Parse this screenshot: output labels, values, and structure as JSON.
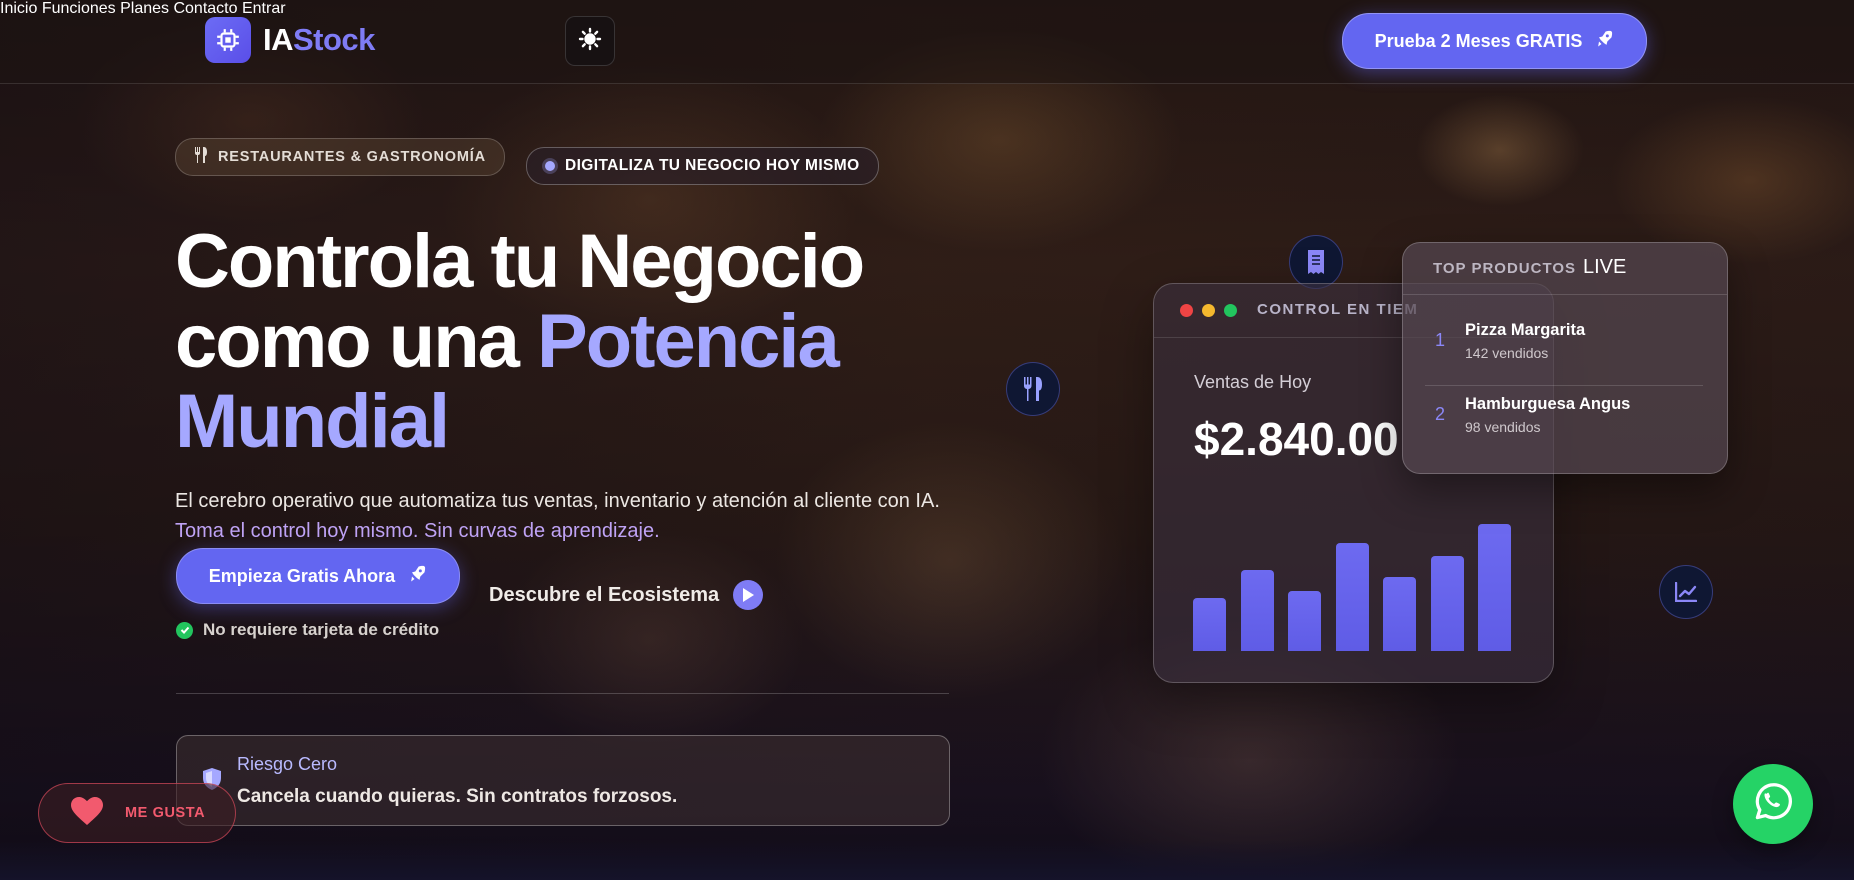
{
  "brand": {
    "prefix": "IA",
    "suffix": "Stock"
  },
  "nav": {
    "items": [
      "Inicio",
      "Funciones",
      "Planes",
      "Contacto",
      "Entrar"
    ],
    "cta_label": "Prueba 2 Meses GRATIS"
  },
  "badges": {
    "category": "RESTAURANTES & GASTRONOMÍA",
    "digitize": "DIGITALIZA TU NEGOCIO HOY MISMO"
  },
  "hero": {
    "title_line1": "Controla tu Negocio",
    "title_line2_plain": "como una",
    "title_line2_accent": "Potencia",
    "title_line3_accent": "Mundial",
    "description_plain": "El cerebro operativo que automatiza tus ventas, inventario y atención al cliente con IA.",
    "description_highlight": "Toma el control hoy mismo. Sin curvas de aprendizaje.",
    "primary_cta": "Empieza Gratis Ahora",
    "secondary_cta": "Descubre el Ecosistema",
    "no_card": "No requiere tarjeta de crédito"
  },
  "risk": {
    "title": "Riesgo Cero",
    "text": "Cancela cuando quieras. Sin contratos forzosos."
  },
  "dashboard": {
    "title": "CONTROL EN TIEM",
    "sales_label": "Ventas de Hoy",
    "sales_value": "$2.840.00",
    "bar_levels": [
      0.41,
      0.62,
      0.46,
      0.83,
      0.57,
      0.73,
      0.98
    ]
  },
  "top_products": {
    "title": "TOP PRODUCTOS",
    "live": "LIVE",
    "items": [
      {
        "rank": "1",
        "name": "Pizza Margarita",
        "sold": "142 vendidos"
      },
      {
        "rank": "2",
        "name": "Hamburguesa Angus",
        "sold": "98 vendidos"
      }
    ]
  },
  "like": {
    "label": "ME GUSTA"
  },
  "colors": {
    "accent": "#6366f1",
    "accent_light": "#a5a8ff",
    "whatsapp": "#25d366",
    "like": "#f25a6e"
  },
  "icons": [
    "chip-icon",
    "sun-icon",
    "rocket-icon",
    "fork-knife-icon",
    "play-icon",
    "check-icon",
    "shield-icon",
    "receipt-icon",
    "chart-line-icon",
    "heart-icon",
    "whatsapp-icon"
  ]
}
